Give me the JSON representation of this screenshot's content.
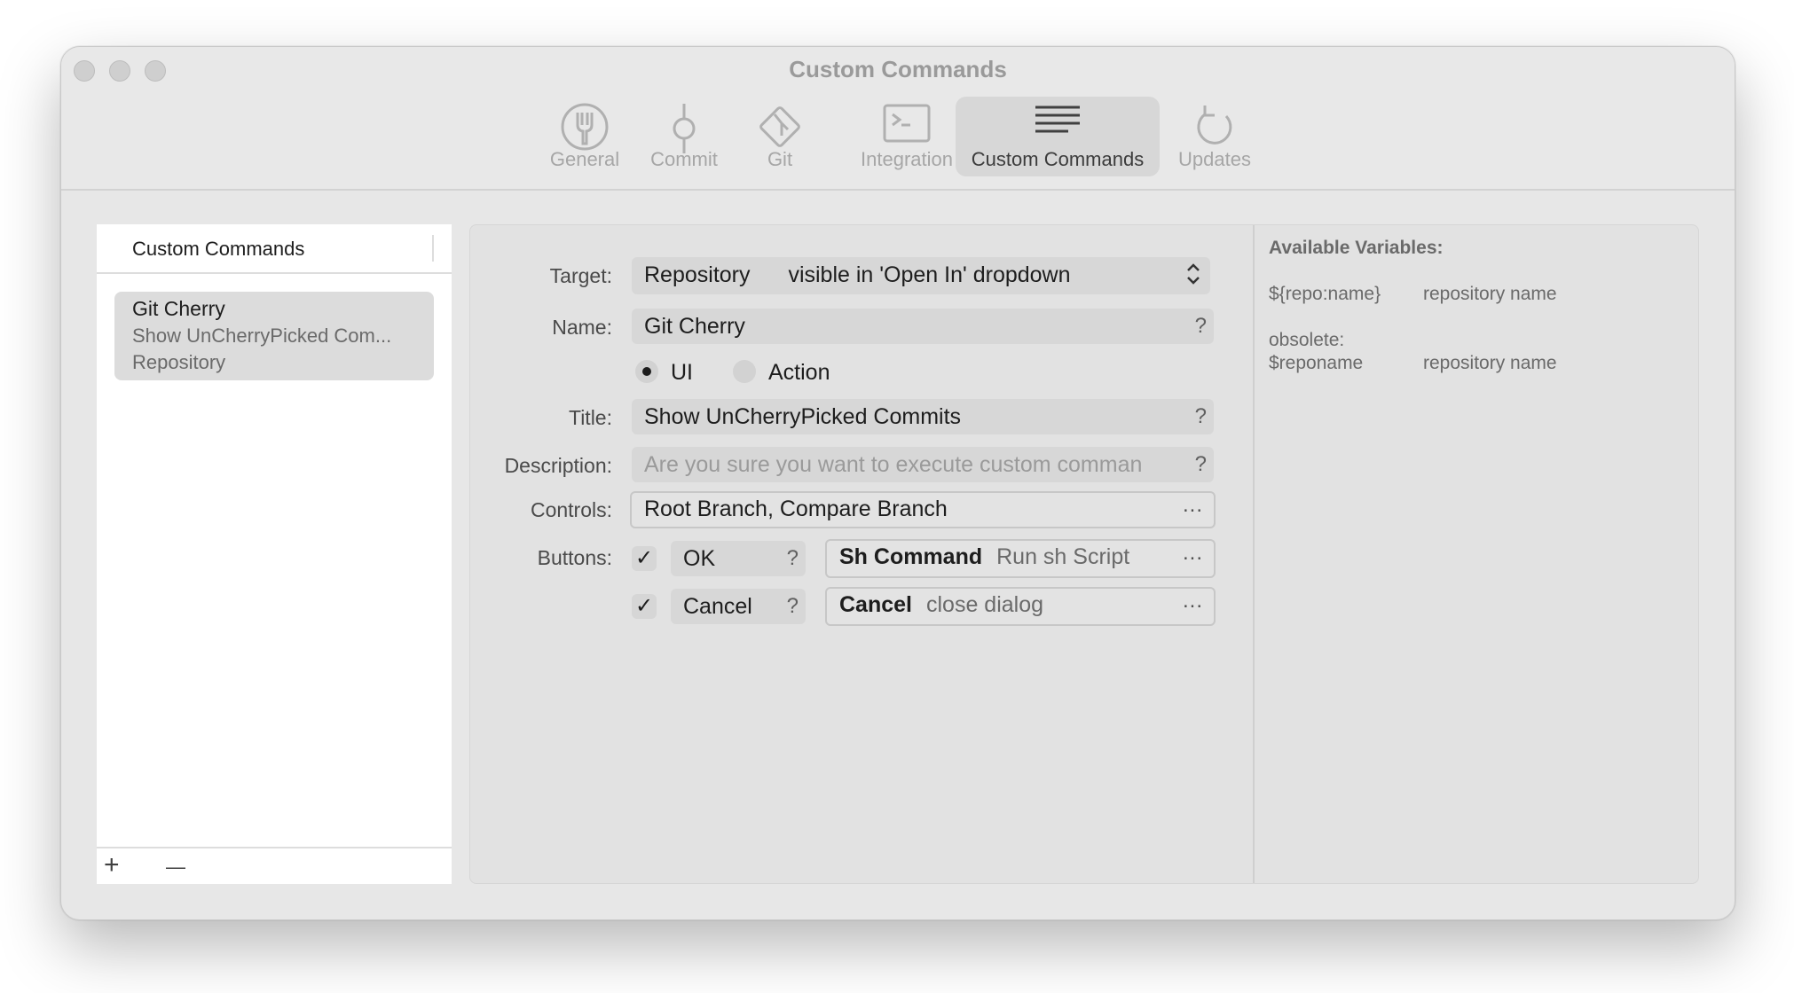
{
  "window": {
    "title": "Custom Commands"
  },
  "toolbar": {
    "items": [
      {
        "label": "General",
        "icon": "fork-icon"
      },
      {
        "label": "Commit",
        "icon": "commit-icon"
      },
      {
        "label": "Git",
        "icon": "git-icon"
      },
      {
        "label": "Integration",
        "icon": "terminal-icon"
      },
      {
        "label": "Custom Commands",
        "icon": "lines-icon",
        "active": true
      },
      {
        "label": "Updates",
        "icon": "refresh-icon"
      }
    ]
  },
  "sidebar": {
    "header": "Custom Commands",
    "items": [
      {
        "name": "Git Cherry",
        "title": "Show UnCherryPicked Com...",
        "target": "Repository"
      }
    ],
    "add_label": "+",
    "remove_label": "—"
  },
  "form": {
    "target": {
      "label": "Target:",
      "value": "Repository",
      "hint": "visible in 'Open In' dropdown"
    },
    "name": {
      "label": "Name:",
      "value": "Git Cherry",
      "help": "?"
    },
    "mode": {
      "ui_label": "UI",
      "action_label": "Action",
      "selected": "UI"
    },
    "title": {
      "label": "Title:",
      "value": "Show UnCherryPicked Commits",
      "help": "?"
    },
    "description": {
      "label": "Description:",
      "placeholder": "Are you sure you want to execute custom comman",
      "help": "?"
    },
    "controls": {
      "label": "Controls:",
      "value": "Root Branch, Compare Branch",
      "more": "..."
    },
    "buttons": {
      "label": "Buttons:",
      "items": [
        {
          "checked": true,
          "name": "OK",
          "help": "?",
          "command": "Sh Command",
          "command_desc": "Run sh Script",
          "more": "..."
        },
        {
          "checked": true,
          "name": "Cancel",
          "help": "?",
          "command": "Cancel",
          "command_desc": "close dialog",
          "more": "..."
        }
      ]
    }
  },
  "variables": {
    "title": "Available Variables:",
    "items": [
      {
        "name": "${repo:name}",
        "desc": "repository name"
      },
      {
        "name_prefix": "obsolete:",
        "name": "$reponame",
        "desc": "repository name"
      }
    ]
  }
}
